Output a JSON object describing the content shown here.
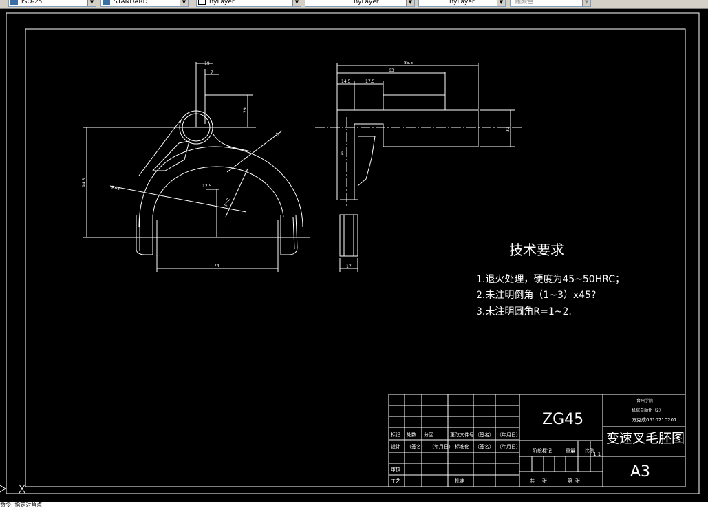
{
  "toolbar": {
    "combo1": "ISO-25",
    "combo2": "STANDARD",
    "layer_color": "ByLayer",
    "layer_linetype": "ByLayer",
    "layer_lineweight": "ByLayer",
    "plot_style": "随颜色"
  },
  "drawing": {
    "tech_title": "技术要求",
    "req1": "1.退火处理，硬度为45~50HRC；",
    "req2": "2.未注明倒角（1~3）x45?",
    "req3": "3.未注明圆角R=1~2.",
    "material": "ZG45",
    "part_name": "变速叉毛胚图",
    "sheet_size": "A3",
    "school": "台州学院",
    "major": "机械自动化（2）",
    "student": "方克成0510210207",
    "dims": {
      "d19": "19",
      "d7": "7",
      "d29": "29",
      "d15": "15",
      "r68": "R68",
      "d125": "12.5",
      "r52": "R52",
      "d945": "94.5",
      "d74": "74",
      "d855": "85.5",
      "d63": "63",
      "d145": "14.5",
      "d175": "17.5",
      "d5": "5",
      "d32": "32",
      "d17": "17"
    },
    "title_block": {
      "biaoji": "标记",
      "chushu": "处数",
      "fenqu": "分区",
      "wenjian": "更改文件号",
      "qianming": "（签名）",
      "nianyueri": "（年月日）",
      "sheji": "设计",
      "biaozhunhua": "标准化",
      "jieduan": "阶段标记",
      "zhongliang": "重量",
      "bili": "比例",
      "bili_val": "1:1",
      "shenhe": "审核",
      "gongyi": "工艺",
      "pizhun": "批准",
      "gong": "共",
      "zhang": "张",
      "di": "第",
      "zhang2": "张"
    }
  },
  "ucs": "X",
  "command_line": "命令: 指定对角点:"
}
